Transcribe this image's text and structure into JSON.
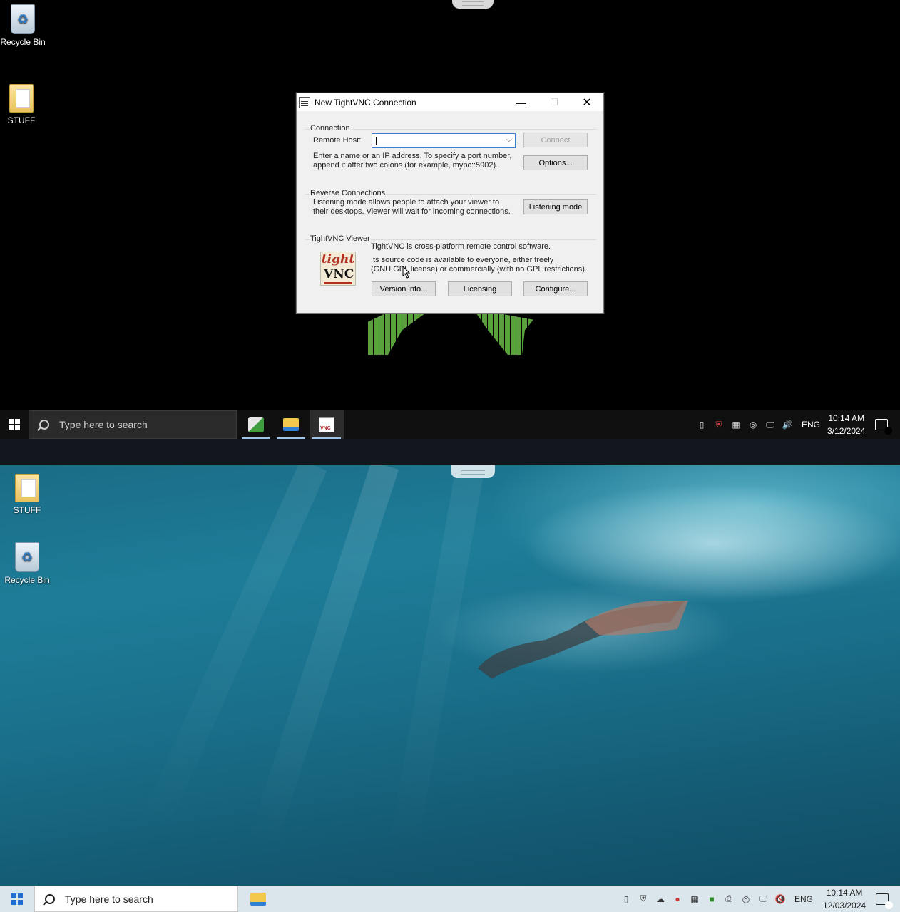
{
  "top": {
    "desktop_icons": [
      {
        "label": "Recycle Bin",
        "icon": "recycle-bin-icon"
      },
      {
        "label": "STUFF",
        "icon": "folder-icon"
      }
    ],
    "dialog": {
      "title": "New TightVNC Connection",
      "connection": {
        "group_label": "Connection",
        "remote_host_label": "Remote Host:",
        "remote_host_value": "",
        "connect_label": "Connect",
        "hint_line1": "Enter a name or an IP address. To specify a port number,",
        "hint_line2": "append it after two colons (for example, mypc::5902).",
        "options_label": "Options..."
      },
      "reverse": {
        "group_label": "Reverse Connections",
        "text_line1": "Listening mode allows people to attach your viewer to",
        "text_line2": "their desktops. Viewer will wait for incoming connections.",
        "listening_label": "Listening mode"
      },
      "viewer": {
        "group_label": "TightVNC Viewer",
        "logo_top": "tight",
        "logo_bottom": "VNC",
        "text_line1": "TightVNC is cross-platform remote control software.",
        "text_line2": "Its source code is available to everyone, either freely",
        "text_line3": "(GNU GPL license) or commercially (with no GPL restrictions).",
        "version_label": "Version info...",
        "licensing_label": "Licensing",
        "configure_label": "Configure..."
      }
    },
    "taskbar": {
      "search_placeholder": "Type here to search",
      "language": "ENG",
      "time": "10:14 AM",
      "date": "3/12/2024",
      "notification_count": "3"
    }
  },
  "bottom": {
    "desktop_icons": [
      {
        "label": "STUFF",
        "icon": "folder-icon"
      },
      {
        "label": "Recycle Bin",
        "icon": "recycle-bin-icon"
      }
    ],
    "taskbar": {
      "search_placeholder": "Type here to search",
      "language": "ENG",
      "time": "10:14 AM",
      "date": "12/03/2024",
      "notification_count": "7"
    }
  }
}
